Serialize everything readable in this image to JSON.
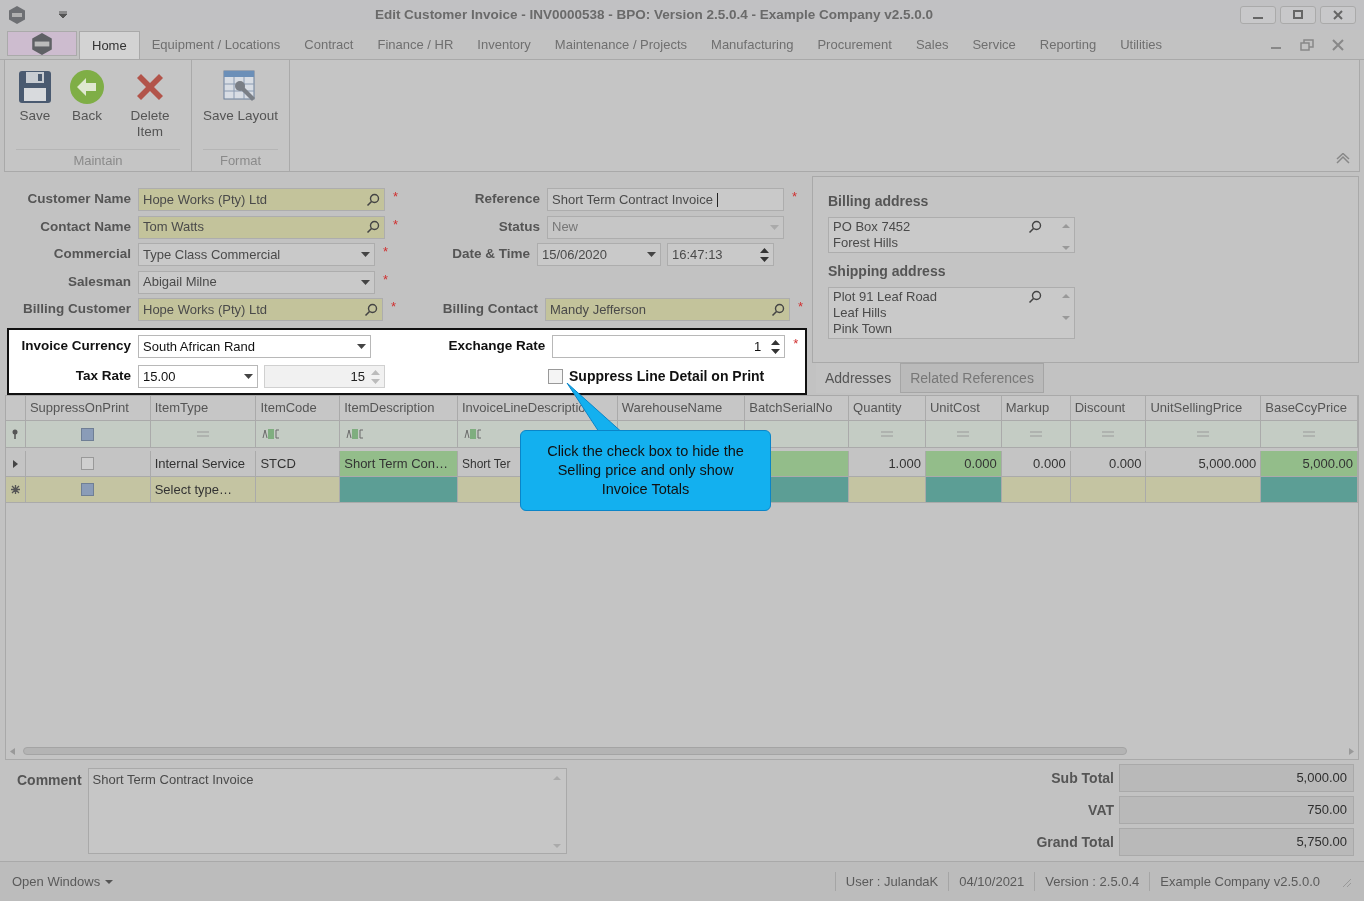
{
  "window": {
    "title": "Edit Customer Invoice - INV0000538 - BPO: Version 2.5.0.4 - Example Company v2.5.0.0"
  },
  "menu_tabs": [
    {
      "label": "Home",
      "selected": true
    },
    {
      "label": "Equipment / Locations",
      "selected": false
    },
    {
      "label": "Contract",
      "selected": false
    },
    {
      "label": "Finance / HR",
      "selected": false
    },
    {
      "label": "Inventory",
      "selected": false
    },
    {
      "label": "Maintenance / Projects",
      "selected": false
    },
    {
      "label": "Manufacturing",
      "selected": false
    },
    {
      "label": "Procurement",
      "selected": false
    },
    {
      "label": "Sales",
      "selected": false
    },
    {
      "label": "Service",
      "selected": false
    },
    {
      "label": "Reporting",
      "selected": false
    },
    {
      "label": "Utilities",
      "selected": false
    }
  ],
  "ribbon": [
    {
      "label": "Maintain",
      "buttons": [
        {
          "kind": "save",
          "label": "Save"
        },
        {
          "kind": "back",
          "label": "Back"
        },
        {
          "kind": "delete",
          "label": "Delete Item"
        }
      ]
    },
    {
      "label": "Format",
      "buttons": [
        {
          "kind": "layout",
          "label": "Save Layout"
        }
      ]
    }
  ],
  "form_rows": [
    {
      "left": {
        "label": "Customer Name",
        "kind": "lookup",
        "value": "Hope Works (Pty) Ltd",
        "mark": "*",
        "disabled": false
      },
      "right": {
        "label": "Reference",
        "kind": "text",
        "value": "Short Term Contract Invoice",
        "mark": "*",
        "disabled": false
      }
    },
    {
      "left": {
        "label": "Contact Name",
        "kind": "lookup",
        "value": "Tom Watts",
        "mark": "*",
        "disabled": false
      },
      "right": {
        "label": "Status",
        "kind": "dropdown",
        "value": "New",
        "disabled": true
      }
    },
    {
      "left": {
        "label": "Commercial",
        "kind": "dropdown",
        "value": "Type Class Commercial",
        "mark": "*",
        "disabled": false
      },
      "right": {
        "label": "Date & Time",
        "kind": "datetime",
        "value": "15/06/2020",
        "time": "16:47:13",
        "disabled": false
      }
    },
    {
      "left": {
        "label": "Salesman",
        "kind": "dropdown",
        "value": "Abigail Milne",
        "mark": "*",
        "disabled": false
      }
    },
    {
      "left": {
        "label": "Billing Customer",
        "kind": "lookup",
        "value": "Hope Works (Pty) Ltd",
        "mark": "*",
        "disabled": false
      },
      "right": {
        "label": "Billing Contact",
        "kind": "lookup",
        "value": "Mandy Jefferson",
        "mark": "*",
        "disabled": false
      }
    }
  ],
  "highlight": {
    "currency": {
      "label": "Invoice Currency",
      "value": "South African Rand"
    },
    "exchange_rate": {
      "label": "Exchange Rate",
      "value": "1",
      "mark": "*"
    },
    "tax_rate": {
      "label": "Tax Rate",
      "value": "15.00",
      "percent": "15"
    },
    "suppress": {
      "label": "Suppress Line Detail on Print",
      "checked": false
    }
  },
  "addresses": [
    {
      "label": "Billing address",
      "lines": [
        "PO Box 7452",
        "Forest Hills"
      ]
    },
    {
      "label": "Shipping address",
      "lines": [
        "Plot 91 Leaf Road",
        "Leaf Hills",
        "Pink Town"
      ]
    }
  ],
  "side_tabs": [
    {
      "label": "Addresses",
      "selected": true
    },
    {
      "label": "Related References",
      "selected": false
    }
  ],
  "grid": {
    "columns": [
      {
        "label": "SuppressOnPrint",
        "highlighted": false
      },
      {
        "label": "ItemType",
        "highlighted": false
      },
      {
        "label": "ItemCode",
        "highlighted": false
      },
      {
        "label": "ItemDescription",
        "highlighted": true
      },
      {
        "label": "InvoiceLineDescriptio",
        "highlighted": false
      },
      {
        "label": "WarehouseName"
      },
      {
        "label": "BatchSerialNo",
        "highlighted": true
      },
      {
        "label": "Quantity",
        "highlighted": false
      },
      {
        "label": "UnitCost",
        "highlighted": true
      },
      {
        "label": "Markup",
        "highlighted": false
      },
      {
        "label": "Discount",
        "highlighted": false
      },
      {
        "label": "UnitSellingPrice",
        "highlighted": false
      },
      {
        "label": "BaseCcyPrice",
        "highlighted": true
      }
    ],
    "filter_row": [
      {
        "kind": "check"
      },
      {
        "kind": "equals"
      },
      {
        "kind": "text"
      },
      {
        "kind": "text"
      },
      {
        "kind": "text"
      },
      {
        "kind": "empty"
      },
      {
        "kind": "empty"
      },
      {
        "kind": "equals"
      },
      {
        "kind": "equals"
      },
      {
        "kind": "equals"
      },
      {
        "kind": "equals"
      },
      {
        "kind": "equals"
      },
      {
        "kind": "equals"
      }
    ],
    "rows": [
      {
        "kind": "data",
        "checked": false,
        "cells": [
          null,
          "Internal Service",
          "STCD",
          "Short Term Con…",
          "Short Ter",
          null,
          null,
          "1.000",
          "0.000",
          "0.000",
          "0.000",
          "5,000.000",
          "5,000.00"
        ]
      },
      {
        "kind": "new",
        "cells": [
          null,
          "Select type…",
          null,
          null,
          null,
          null,
          null,
          null,
          null,
          null,
          null,
          null,
          null
        ]
      }
    ]
  },
  "callout": "Click the check box to hide the Selling price and only show Invoice Totals",
  "comment": {
    "label": "Comment",
    "value": "Short Term Contract Invoice"
  },
  "totals": [
    {
      "label": "Sub Total",
      "value": "5,000.00"
    },
    {
      "label": "VAT",
      "value": "750.00"
    },
    {
      "label": "Grand Total",
      "value": "5,750.00"
    }
  ],
  "status_bar": {
    "menu": "Open Windows",
    "items": [
      "User : JulandaK",
      "04/10/2021",
      "Version : 2.5.0.4",
      "Example Company v2.5.0.0"
    ]
  }
}
